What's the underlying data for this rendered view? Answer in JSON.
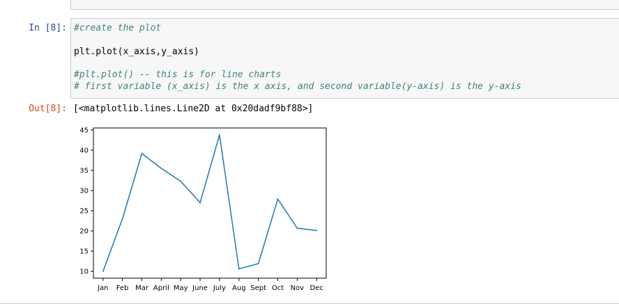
{
  "input_cell": {
    "prompt": "In [8]:",
    "lines": [
      "#create the plot",
      "plt.plot(x_axis,y_axis)",
      "#plt.plot() -- this is for line charts",
      "# first variable (x_axis) is the x axis, and second variable(y-axis) is the y-axis"
    ]
  },
  "output_cell": {
    "prompt": "Out[8]:",
    "text": "[<matplotlib.lines.Line2D at 0x20dadf9bf88>]"
  },
  "chart_data": {
    "type": "line",
    "categories": [
      "Jan",
      "Feb",
      "Mar",
      "April",
      "May",
      "June",
      "July",
      "Aug",
      "Sept",
      "Oct",
      "Nov",
      "Dec"
    ],
    "values": [
      10.0,
      23.0,
      39.2,
      35.5,
      32.3,
      27.0,
      43.8,
      10.6,
      11.9,
      27.9,
      20.7,
      20.1
    ],
    "ylim": [
      8.3,
      45.5
    ],
    "yticks": [
      10,
      15,
      20,
      25,
      30,
      35,
      40,
      45
    ],
    "line_color": "#1f77b4"
  }
}
